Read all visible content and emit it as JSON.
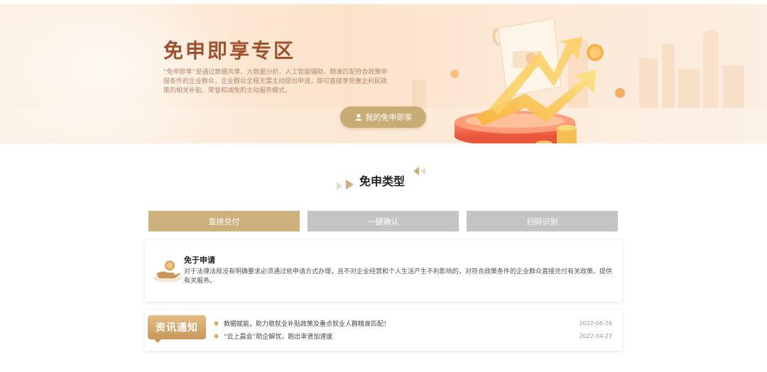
{
  "banner": {
    "title": "免申即享专区",
    "description": "“免申即享”是通过数据共享、大数据分析、人工智能辅助、精准匹配符合政策申报条件的企业群众，企业群众全程无需主动提出申请，即可直接享受惠企利民政策的相关补贴、荣誉和减免的主动服务模式。",
    "button_label": "我的免申即享",
    "button_icon": "user-icon"
  },
  "section": {
    "title": "免申类型"
  },
  "tabs": [
    {
      "label": "直接兑付",
      "active": true
    },
    {
      "label": "一键确认",
      "active": false
    },
    {
      "label": "扫码识别",
      "active": false
    }
  ],
  "card": {
    "icon": "hand-coin-icon",
    "title": "免于申请",
    "description": "对于法律法规没有明确要求必须通过依申请方式办理，且不对企业经营和个人生活产生不利影响的，对符合政策条件的企业群众直接兑付有关政策、提供有关服务。"
  },
  "news": {
    "badge": "资讯通知",
    "items": [
      {
        "title": "数据赋能，助力稳就业补贴政策及重点就业人群精准匹配！",
        "date": "2022-06-26"
      },
      {
        "title": "“云上晨会”助企解忧，跑出幸贤加速度",
        "date": "2022-04-27"
      }
    ]
  },
  "colors": {
    "accent": "#cdb17c",
    "inactive_tab": "#c4c4c4",
    "title_brown": "#a0522d"
  }
}
